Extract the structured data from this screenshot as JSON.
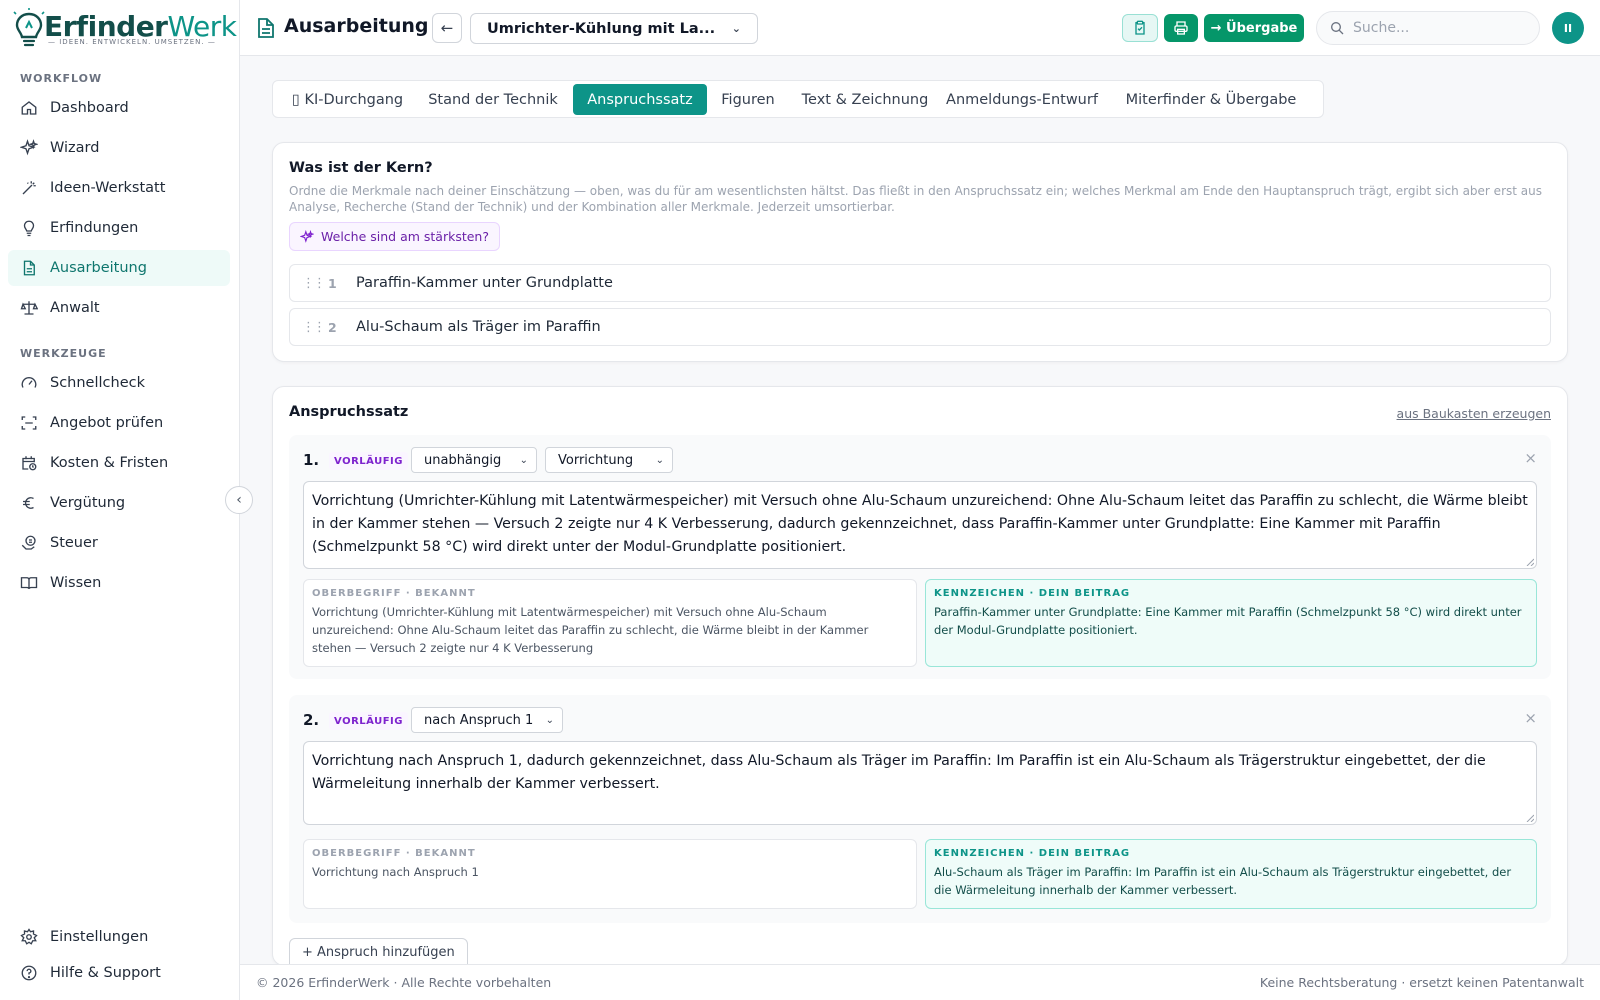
{
  "brand": {
    "name_part1": "Erfinder",
    "name_part2": "Werk",
    "tagline": "IDEEN. ENTWICKELN. UMSETZEN."
  },
  "sidebar": {
    "workflow_label": "WORKFLOW",
    "workflow_items": [
      {
        "label": "Dashboard",
        "icon": "home-icon"
      },
      {
        "label": "Wizard",
        "icon": "sparkles-icon"
      },
      {
        "label": "Ideen-Werkstatt",
        "icon": "wand-icon"
      },
      {
        "label": "Erfindungen",
        "icon": "lightbulb-icon"
      },
      {
        "label": "Ausarbeitung",
        "icon": "document-icon",
        "active": true
      },
      {
        "label": "Anwalt",
        "icon": "scales-icon"
      }
    ],
    "tools_label": "WERKZEUGE",
    "tool_items": [
      {
        "label": "Schnellcheck",
        "icon": "gauge-icon"
      },
      {
        "label": "Angebot prüfen",
        "icon": "scan-icon"
      },
      {
        "label": "Kosten & Fristen",
        "icon": "calendar-clock-icon"
      },
      {
        "label": "Vergütung",
        "icon": "euro-icon"
      },
      {
        "label": "Steuer",
        "icon": "tax-icon"
      },
      {
        "label": "Wissen",
        "icon": "book-icon"
      }
    ],
    "bottom_items": [
      {
        "label": "Einstellungen",
        "icon": "gear-icon"
      },
      {
        "label": "Hilfe & Support",
        "icon": "help-icon"
      }
    ]
  },
  "header": {
    "title": "Ausarbeitung",
    "invention_select": "Umrichter-Kühlung mit La...",
    "handover_label": "→ Übergabe",
    "search_placeholder": "Suche...",
    "avatar_initials": "II"
  },
  "tabs": [
    {
      "label": "▯ KI-Durchgang"
    },
    {
      "label": "Stand der Technik"
    },
    {
      "label": "Anspruchssatz",
      "active": true
    },
    {
      "label": "Figuren"
    },
    {
      "label": "Text & Zeichnung"
    },
    {
      "label": "Anmeldungs-Entwurf"
    },
    {
      "label": "Miterfinder & Übergabe"
    }
  ],
  "core": {
    "title": "Was ist der Kern?",
    "description": "Ordne die Merkmale nach deiner Einschätzung — oben, was du für am wesentlichsten hältst. Das fließt in den Anspruchssatz ein; welches Merkmal am Ende den Hauptanspruch trägt, ergibt sich aber erst aus Analyse, Recherche (Stand der Technik) und der Kombination aller Merkmale. Jederzeit umsortierbar.",
    "strongest_button": "Welche sind am stärksten?",
    "features": [
      {
        "num": "1",
        "text": "Paraffin-Kammer unter Grundplatte"
      },
      {
        "num": "2",
        "text": "Alu-Schaum als Träger im Paraffin"
      }
    ]
  },
  "claims_section": {
    "title": "Anspruchssatz",
    "from_kit_link": "aus Baukasten erzeugen",
    "add_claim_button": "+ Anspruch hinzufügen",
    "known_label": "OBERBEGRIFF · BEKANNT",
    "own_label": "KENNZEICHEN · DEIN BEITRAG",
    "claims": [
      {
        "num": "1.",
        "badge": "VORLÄUFIG",
        "type_select": "unabhängig",
        "category_select": "Vorrichtung",
        "text": "Vorrichtung (Umrichter-Kühlung mit Latentwärmespeicher) mit Versuch ohne Alu-Schaum unzureichend: Ohne Alu-Schaum leitet das Paraffin zu schlecht, die Wärme bleibt in der Kammer stehen — Versuch 2 zeigte nur 4 K Verbesserung, dadurch gekennzeichnet, dass Paraffin-Kammer unter Grundplatte: Eine Kammer mit Paraffin (Schmelzpunkt 58 °C) wird direkt unter der Modul-Grundplatte positioniert.",
        "known": "Vorrichtung (Umrichter-Kühlung mit Latentwärmespeicher) mit Versuch ohne Alu-Schaum unzureichend: Ohne Alu-Schaum leitet das Paraffin zu schlecht, die Wärme bleibt in der Kammer stehen — Versuch 2 zeigte nur 4 K Verbesserung",
        "own": "Paraffin-Kammer unter Grundplatte: Eine Kammer mit Paraffin (Schmelzpunkt 58 °C) wird direkt unter der Modul-Grundplatte positioniert."
      },
      {
        "num": "2.",
        "badge": "VORLÄUFIG",
        "type_select": "nach Anspruch 1",
        "text": "Vorrichtung nach Anspruch 1, dadurch gekennzeichnet, dass Alu-Schaum als Träger im Paraffin: Im Paraffin ist ein Alu-Schaum als Trägerstruktur eingebettet, der die Wärmeleitung innerhalb der Kammer verbessert.",
        "known": "Vorrichtung nach Anspruch 1",
        "own": "Alu-Schaum als Träger im Paraffin: Im Paraffin ist ein Alu-Schaum als Trägerstruktur eingebettet, der die Wärmeleitung innerhalb der Kammer verbessert."
      }
    ]
  },
  "footer": {
    "copyright": "© 2026 ErfinderWerk · Alle Rechte vorbehalten",
    "disclaimer": "Keine Rechtsberatung · ersetzt keinen Patentanwalt"
  },
  "colors": {
    "accent": "#0d9488",
    "primary_button": "#059669",
    "brand_dark": "#134e4a",
    "badge_purple": "#7e22ce"
  }
}
